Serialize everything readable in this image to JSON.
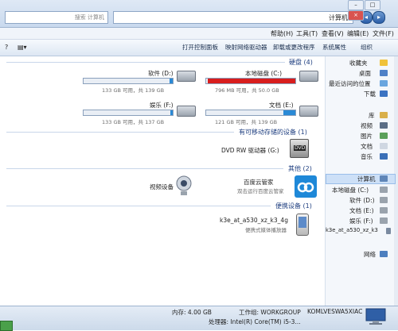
{
  "window": {
    "breadcrumb": "计算机",
    "search_placeholder": "搜索 计算机"
  },
  "menu": {
    "file": "文件(F)",
    "edit": "编辑(E)",
    "view": "查看(V)",
    "tools": "工具(T)",
    "help": "帮助(H)"
  },
  "commands": {
    "organize": "组织",
    "properties": "系统属性",
    "uninstall": "卸载或更改程序",
    "map_drive": "映射网络驱动器",
    "control_panel": "打开控制面板"
  },
  "sections": {
    "hard_disks": "硬盘 (4)",
    "removable": "有可移动存储的设备 (1)",
    "other": "其他 (2)",
    "portable": "便携设备 (1)"
  },
  "drives": [
    {
      "name": "本地磁盘 (C:)",
      "space": "796 MB 可用，共 50.0 GB",
      "used_fraction": 0.985,
      "color": "#d81e1e"
    },
    {
      "name": "软件 (D:)",
      "space": "133 GB 可用，共 139 GB",
      "used_fraction": 0.04,
      "color": "#2a8ad6"
    },
    {
      "name": "文档 (E:)",
      "space": "121 GB 可用，共 139 GB",
      "used_fraction": 0.13,
      "color": "#2a8ad6"
    },
    {
      "name": "娱乐 (F:)",
      "space": "133 GB 可用，共 137 GB",
      "used_fraction": 0.03,
      "color": "#2a8ad6"
    }
  ],
  "removable": {
    "name": "DVD RW 驱动器 (G:)"
  },
  "other": [
    {
      "name": "百度云管家",
      "sub": "双击运行百度云管家"
    },
    {
      "name": "视频设备",
      "sub": ""
    }
  ],
  "portable": {
    "name": "k3e_at_a530_xz_k3_4g",
    "sub": "便携式媒体播放器"
  },
  "nav": {
    "favorites": "收藏夹",
    "fav_items": [
      "桌面",
      "最近访问的位置",
      "下载"
    ],
    "libraries": "库",
    "lib_items": [
      "视频",
      "图片",
      "文档",
      "音乐"
    ],
    "computer": "计算机",
    "comp_items": [
      "本地磁盘 (C:)",
      "软件 (D:)",
      "文档 (E:)",
      "娱乐 (F:)",
      "k3e_at_a530_xz_k3"
    ],
    "network": "网络"
  },
  "status": {
    "computer_name": "KOMLVESWA5XIAC",
    "workgroup": "工作组: WORKGROUP",
    "memory": "内存: 4.00 GB",
    "processor": "处理器: Intel(R) Core(TM) i5-3..."
  }
}
